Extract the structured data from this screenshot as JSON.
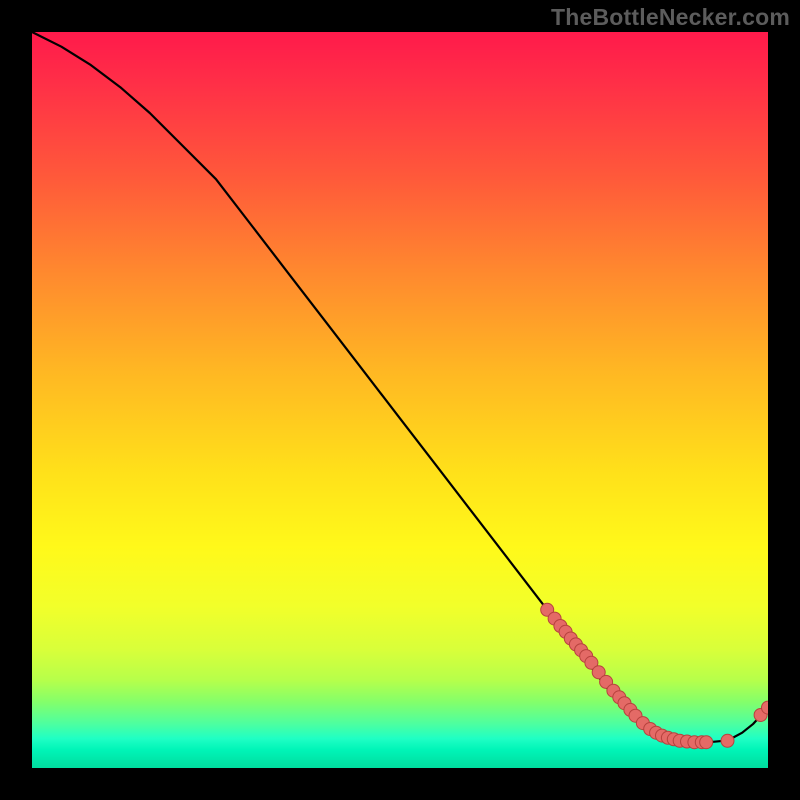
{
  "watermark": "TheBottleNecker.com",
  "chart_data": {
    "type": "line",
    "title": "",
    "xlabel": "",
    "ylabel": "",
    "xlim": [
      0,
      100
    ],
    "ylim": [
      0,
      100
    ],
    "series": [
      {
        "name": "curve",
        "x": [
          0,
          4,
          8,
          12,
          16,
          20,
          25,
          30,
          35,
          40,
          45,
          50,
          55,
          60,
          65,
          70,
          75,
          78,
          80,
          82,
          84,
          86,
          88,
          90,
          92,
          94,
          95,
          96.5,
          98,
          100
        ],
        "y": [
          100,
          98,
          95.5,
          92.5,
          89,
          85,
          80,
          73.5,
          67,
          60.5,
          54,
          47.5,
          41,
          34.5,
          28,
          21.5,
          15,
          11,
          8.5,
          6.6,
          5.2,
          4.3,
          3.8,
          3.5,
          3.5,
          3.7,
          4.0,
          4.8,
          6.0,
          8.2
        ]
      }
    ],
    "markers": [
      {
        "x": 70.0,
        "y": 21.5
      },
      {
        "x": 71.0,
        "y": 20.3
      },
      {
        "x": 71.8,
        "y": 19.3
      },
      {
        "x": 72.5,
        "y": 18.5
      },
      {
        "x": 73.2,
        "y": 17.6
      },
      {
        "x": 73.9,
        "y": 16.8
      },
      {
        "x": 74.6,
        "y": 16.0
      },
      {
        "x": 75.3,
        "y": 15.2
      },
      {
        "x": 76.0,
        "y": 14.3
      },
      {
        "x": 77.0,
        "y": 13.0
      },
      {
        "x": 78.0,
        "y": 11.7
      },
      {
        "x": 79.0,
        "y": 10.5
      },
      {
        "x": 79.8,
        "y": 9.6
      },
      {
        "x": 80.5,
        "y": 8.8
      },
      {
        "x": 81.3,
        "y": 7.9
      },
      {
        "x": 82.0,
        "y": 7.1
      },
      {
        "x": 83.0,
        "y": 6.1
      },
      {
        "x": 84.0,
        "y": 5.3
      },
      {
        "x": 84.8,
        "y": 4.8
      },
      {
        "x": 85.6,
        "y": 4.4
      },
      {
        "x": 86.4,
        "y": 4.1
      },
      {
        "x": 87.2,
        "y": 3.9
      },
      {
        "x": 88.0,
        "y": 3.7
      },
      {
        "x": 89.0,
        "y": 3.6
      },
      {
        "x": 90.0,
        "y": 3.5
      },
      {
        "x": 91.0,
        "y": 3.5
      },
      {
        "x": 91.6,
        "y": 3.5
      },
      {
        "x": 94.5,
        "y": 3.7
      },
      {
        "x": 99.0,
        "y": 7.2
      },
      {
        "x": 100.0,
        "y": 8.2
      }
    ],
    "colors": {
      "line": "#000000",
      "marker_fill": "#e46a66",
      "marker_stroke": "#b7423e",
      "gradient_top": "#ff1a4b",
      "gradient_bottom": "#00dd9f"
    }
  }
}
